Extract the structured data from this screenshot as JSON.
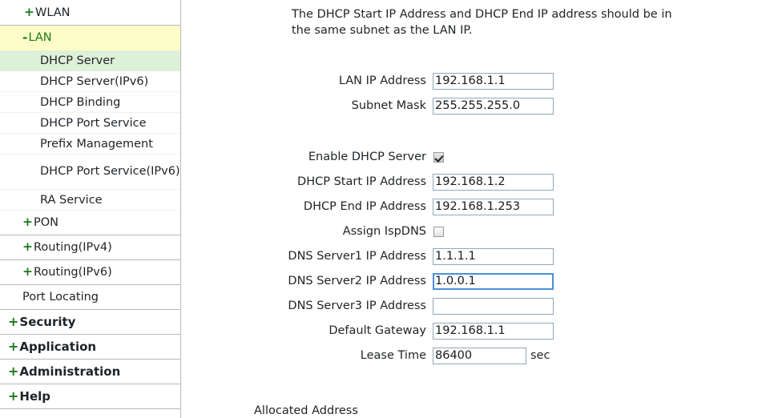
{
  "sidebar": {
    "items": [
      {
        "prefix": "+",
        "label": "WLAN",
        "type": "top",
        "state": "collapsed"
      },
      {
        "prefix": "-",
        "label": "LAN",
        "type": "expanded-parent",
        "state": "expanded"
      },
      {
        "prefix": "",
        "label": "DHCP Server",
        "type": "child",
        "state": "active"
      },
      {
        "prefix": "",
        "label": "DHCP Server(IPv6)",
        "type": "child",
        "state": "normal"
      },
      {
        "prefix": "",
        "label": "DHCP Binding",
        "type": "child",
        "state": "normal"
      },
      {
        "prefix": "",
        "label": "DHCP Port Service",
        "type": "child",
        "state": "normal"
      },
      {
        "prefix": "",
        "label": "Prefix Management",
        "type": "child",
        "state": "normal"
      },
      {
        "prefix": "",
        "label": "DHCP Port Service(IPv6)",
        "type": "child-wrap",
        "state": "normal"
      },
      {
        "prefix": "",
        "label": "RA Service",
        "type": "child",
        "state": "normal"
      },
      {
        "prefix": "+",
        "label": "PON",
        "type": "group",
        "state": "collapsed"
      },
      {
        "prefix": "+",
        "label": "Routing(IPv4)",
        "type": "group",
        "state": "collapsed"
      },
      {
        "prefix": "+",
        "label": "Routing(IPv6)",
        "type": "group",
        "state": "collapsed"
      },
      {
        "prefix": "",
        "label": "Port Locating",
        "type": "plain",
        "state": "normal"
      },
      {
        "prefix": "+",
        "label": "Security",
        "type": "section",
        "state": "collapsed"
      },
      {
        "prefix": "+",
        "label": "Application",
        "type": "section",
        "state": "collapsed"
      },
      {
        "prefix": "+",
        "label": "Administration",
        "type": "section",
        "state": "collapsed"
      },
      {
        "prefix": "+",
        "label": "Help",
        "type": "section",
        "state": "collapsed"
      }
    ],
    "colors": {
      "expanded_parent_bg": "#fdfdc8",
      "active_child_bg": "#ddf0d8",
      "marker": "#1a7a1a",
      "divider": "#b9b9b9"
    }
  },
  "main": {
    "hint": "The DHCP Start IP Address and DHCP End IP address should be in the same subnet as the LAN IP.",
    "fields": {
      "lan_ip_label": "LAN IP Address",
      "lan_ip_value": "192.168.1.1",
      "subnet_mask_label": "Subnet Mask",
      "subnet_mask_value": "255.255.255.0",
      "enable_dhcp_label": "Enable DHCP Server",
      "enable_dhcp_checked": "checked",
      "dhcp_start_label": "DHCP Start IP Address",
      "dhcp_start_value": "192.168.1.2",
      "dhcp_end_label": "DHCP End IP Address",
      "dhcp_end_value": "192.168.1.253",
      "assign_ispdns_label": "Assign IspDNS",
      "assign_ispdns_checked": "unchecked",
      "dns1_label": "DNS Server1 IP Address",
      "dns1_value": "1.1.1.1",
      "dns2_label": "DNS Server2 IP Address",
      "dns2_value": "1.0.0.1",
      "dns3_label": "DNS Server3 IP Address",
      "dns3_value": "",
      "gateway_label": "Default Gateway",
      "gateway_value": "192.168.1.1",
      "lease_time_label": "Lease Time",
      "lease_time_value": "86400",
      "lease_time_unit": "sec"
    },
    "allocated_address_heading": "Allocated Address",
    "focused_field": "dns2",
    "focus_color": "#4a90d9",
    "input_border_color": "#8fa8bd"
  }
}
